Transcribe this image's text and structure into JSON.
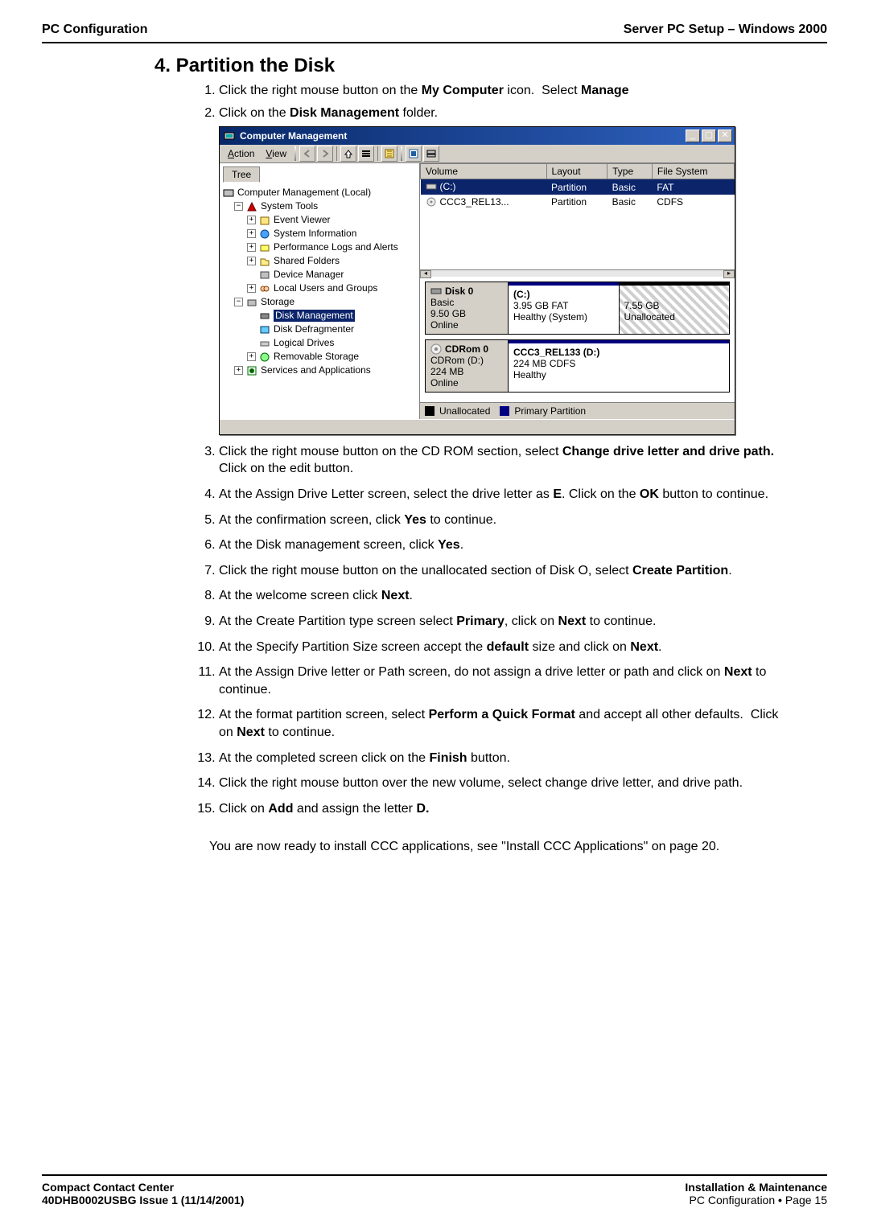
{
  "header": {
    "left": "PC Configuration",
    "right": "Server PC Setup – Windows 2000"
  },
  "section": {
    "title": "4. Partition the Disk"
  },
  "intro": {
    "s1": {
      "bold1": "My Computer",
      "bold2": "Manage"
    },
    "s2": {
      "bold": "Disk Management"
    }
  },
  "win": {
    "title": "Computer Management",
    "menu": {
      "action": "ction",
      "view": "iew"
    },
    "treeTab": "Tree",
    "tree": {
      "root": "Computer Management (Local)",
      "systemTools": "System Tools",
      "items": [
        "Event Viewer",
        "System Information",
        "Performance Logs and Alerts",
        "Shared Folders",
        "Device Manager",
        "Local Users and Groups"
      ],
      "storage": "Storage",
      "storageItems": [
        "Disk Management",
        "Disk Defragmenter",
        "Logical Drives",
        "Removable Storage"
      ],
      "services": "Services and Applications"
    },
    "cols": [
      "Volume",
      "Layout",
      "Type",
      "File System"
    ],
    "rows": [
      {
        "volume": "(C:)",
        "layout": "Partition",
        "type": "Basic",
        "fs": "FAT"
      },
      {
        "volume": "CCC3_REL13...",
        "layout": "Partition",
        "type": "Basic",
        "fs": "CDFS"
      }
    ],
    "disk0": {
      "name": "Disk 0",
      "kind": "Basic",
      "size": "9.50 GB",
      "status": "Online",
      "parts": [
        {
          "name": "(C:)",
          "line2": "3.95 GB FAT",
          "line3": "Healthy (System)"
        },
        {
          "name": "",
          "line2": "7.55 GB",
          "line3": "Unallocated"
        }
      ]
    },
    "cd0": {
      "name": "CDRom 0",
      "kind": "CDRom (D:)",
      "size": "224 MB",
      "status": "Online",
      "parts": [
        {
          "name": "CCC3_REL133 (D:)",
          "line2": "224 MB CDFS",
          "line3": "Healthy"
        }
      ]
    },
    "legend": [
      "Unallocated",
      "Primary Partition"
    ]
  },
  "steps": {
    "s3": {
      "b1": "Change drive letter and drive path."
    },
    "s4": {
      "b1": "E",
      "b2": "OK"
    },
    "s5": {
      "b1": "Yes"
    },
    "s6": {
      "b1": "Yes"
    },
    "s7": {
      "b1": "Create Partition"
    },
    "s8": {
      "b1": "Next"
    },
    "s9": {
      "b1": "Primary",
      "b2": "Next"
    },
    "s10": {
      "b1": "default",
      "b2": "Next"
    },
    "s11": {
      "b1": "Next"
    },
    "s12": {
      "b1": "Perform a Quick Format",
      "b2": "Next"
    },
    "s13": {
      "b1": "Finish"
    },
    "s15": {
      "b1": "Add",
      "b2": "D."
    }
  },
  "closing": "You are now ready to install CCC applications, see \"Install CCC Applications\" on page 20.",
  "footer": {
    "left1": "Compact Contact Center",
    "left2": "40DHB0002USBG Issue 1 (11/14/2001)",
    "right1": "Installation & Maintenance",
    "right2a": "PC Configuration",
    "right2b": "Page 15"
  }
}
